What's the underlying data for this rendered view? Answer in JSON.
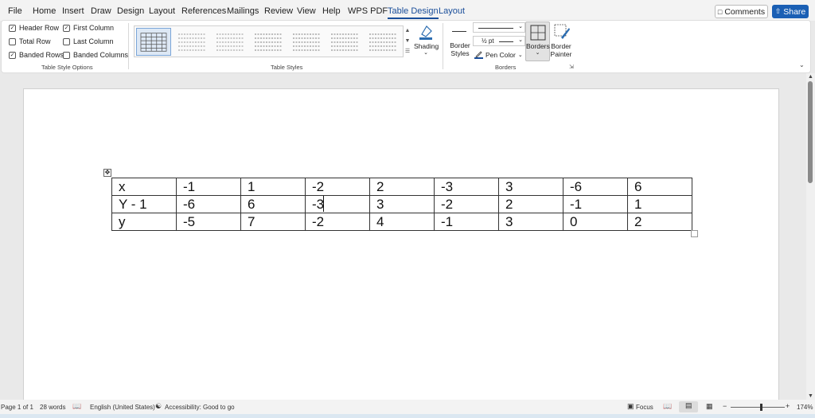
{
  "menu": {
    "items": [
      "File",
      "Home",
      "Insert",
      "Draw",
      "Design",
      "Layout",
      "References",
      "Mailings",
      "Review",
      "View",
      "Help",
      "WPS PDF",
      "Table Design",
      "Layout"
    ],
    "active_index": 12,
    "comments_label": "Comments",
    "share_label": "Share"
  },
  "ribbon": {
    "table_style_options": {
      "header_row": "Header Row",
      "total_row": "Total Row",
      "banded_rows": "Banded Rows",
      "first_column": "First Column",
      "last_column": "Last Column",
      "banded_columns": "Banded Columns",
      "group_label": "Table Style Options"
    },
    "table_styles_label": "Table Styles",
    "shading_label": "Shading",
    "border_styles_label": "Border Styles",
    "pen_weight": "½ pt",
    "pen_color_label": "Pen Color",
    "borders_label": "Borders",
    "border_painter_label": "Border Painter",
    "borders_group_label": "Borders"
  },
  "table": {
    "rows": [
      [
        "x",
        "-1",
        "1",
        "-2",
        "2",
        "-3",
        "3",
        "-6",
        "6"
      ],
      [
        "Y - 1",
        "-6",
        "6",
        "-3",
        "3",
        "-2",
        "2",
        "-1",
        "1"
      ],
      [
        "y",
        "-5",
        "7",
        "-2",
        "4",
        "-1",
        "3",
        "0",
        "2"
      ]
    ]
  },
  "status": {
    "page": "Page 1 of 1",
    "words": "28 words",
    "language": "English (United States)",
    "accessibility": "Accessibility: Good to go",
    "focus": "Focus",
    "zoom": "174%"
  },
  "colors": {
    "accent": "#1a5fb4",
    "pen_color": "#1a4e9a"
  }
}
